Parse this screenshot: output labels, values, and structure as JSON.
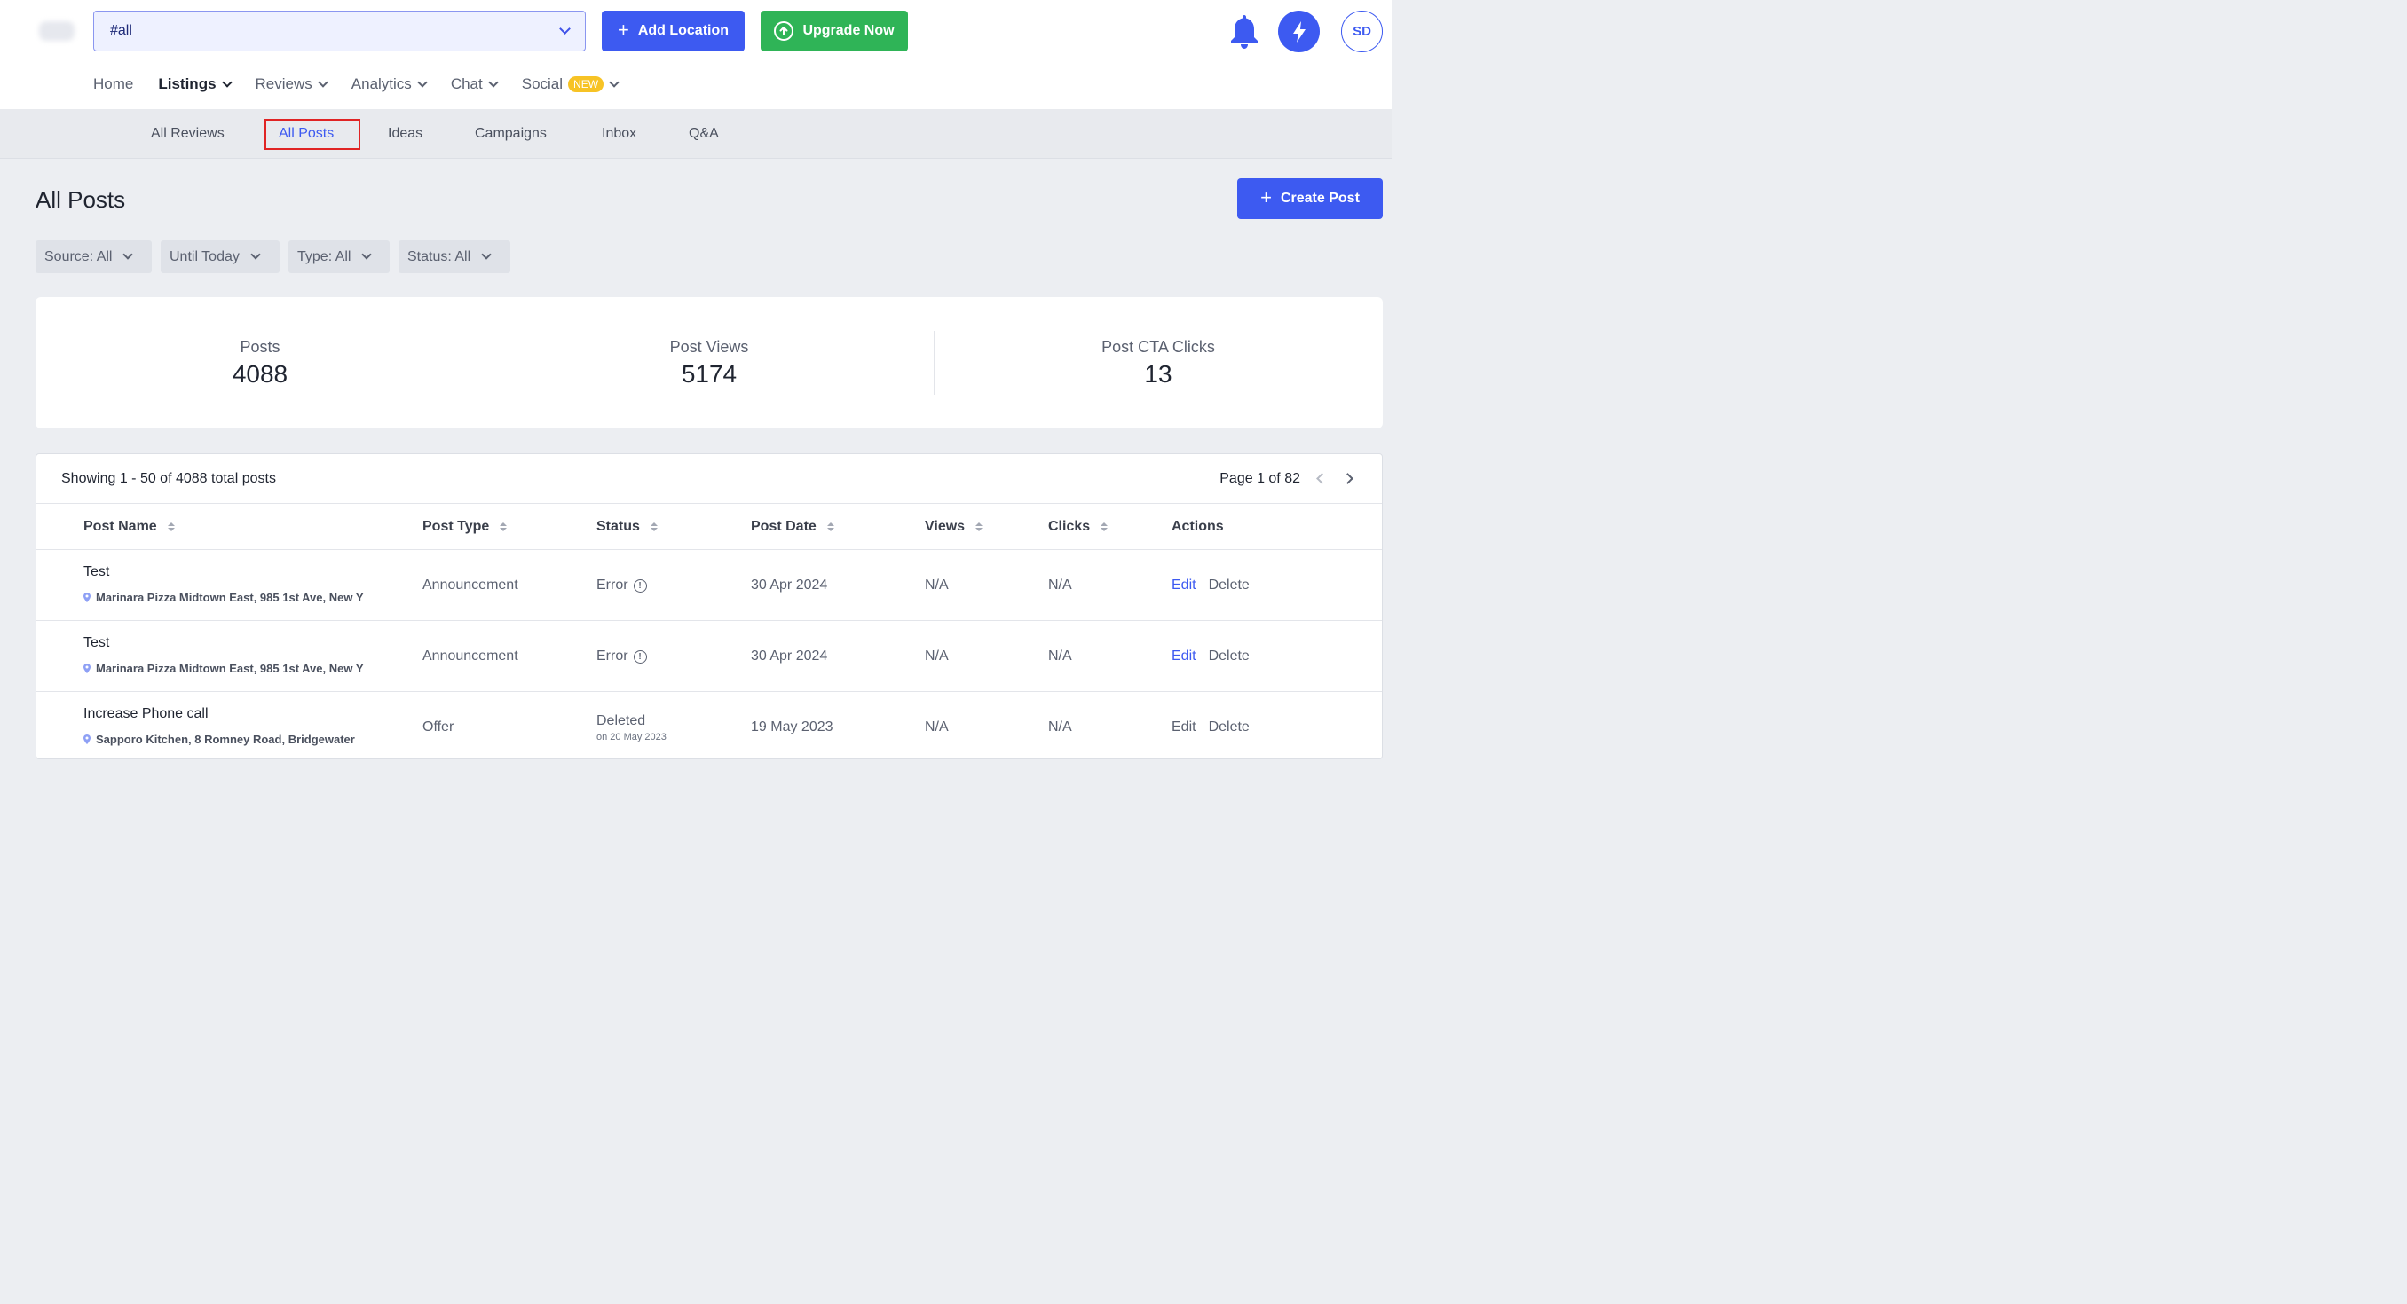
{
  "header": {
    "location_select_value": "#all",
    "add_location_label": "Add Location",
    "upgrade_label": "Upgrade Now",
    "avatar_initials": "SD"
  },
  "main_nav": {
    "home": "Home",
    "listings": "Listings",
    "reviews": "Reviews",
    "analytics": "Analytics",
    "chat": "Chat",
    "social": "Social",
    "social_badge": "NEW"
  },
  "sub_nav": {
    "all_reviews": "All Reviews",
    "all_posts": "All Posts",
    "ideas": "Ideas",
    "campaigns": "Campaigns",
    "inbox": "Inbox",
    "qa": "Q&A"
  },
  "page": {
    "title": "All Posts",
    "create_post_label": "Create Post"
  },
  "filters": {
    "source": "Source: All",
    "date": "Until Today",
    "type": "Type: All",
    "status": "Status: All"
  },
  "stats": {
    "posts_label": "Posts",
    "posts_value": "4088",
    "views_label": "Post Views",
    "views_value": "5174",
    "clicks_label": "Post CTA Clicks",
    "clicks_value": "13"
  },
  "table": {
    "showing_text": "Showing 1 - 50 of 4088 total posts",
    "page_text": "Page 1 of 82",
    "columns": {
      "post_name": "Post Name",
      "post_type": "Post Type",
      "status": "Status",
      "post_date": "Post Date",
      "views": "Views",
      "clicks": "Clicks",
      "actions": "Actions"
    },
    "rows": [
      {
        "name": "Test",
        "location": "Marinara Pizza Midtown East, 985 1st Ave, New Y",
        "type": "Announcement",
        "status": "Error",
        "date": "30 Apr 2024",
        "views": "N/A",
        "clicks": "N/A",
        "edit": "Edit",
        "delete": "Delete"
      },
      {
        "name": "Test",
        "location": "Marinara Pizza Midtown East, 985 1st Ave, New Y",
        "type": "Announcement",
        "status": "Error",
        "date": "30 Apr 2024",
        "views": "N/A",
        "clicks": "N/A",
        "edit": "Edit",
        "delete": "Delete"
      },
      {
        "name": "Increase Phone call",
        "location": "Sapporo Kitchen, 8 Romney Road, Bridgewater",
        "type": "Offer",
        "status": "Deleted",
        "status_sub": "on 20 May 2023",
        "date": "19 May 2023",
        "views": "N/A",
        "clicks": "N/A",
        "edit": "Edit",
        "delete": "Delete"
      }
    ]
  }
}
